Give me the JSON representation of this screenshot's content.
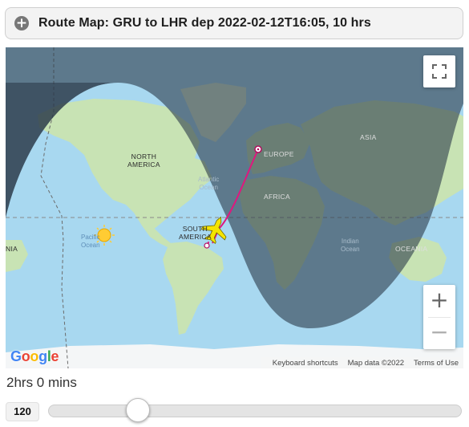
{
  "header": {
    "title": "Route Map: GRU to LHR dep 2022-02-12T16:05, 10 hrs",
    "expand_icon": "plus-circle-icon"
  },
  "map": {
    "labels": {
      "north_america": "NORTH\nAMERICA",
      "south_america": "SOUTH\nAMERICA",
      "europe": "EUROPE",
      "africa": "AFRICA",
      "asia": "ASIA",
      "oceania": "OCEANIA",
      "oceania_left": "NIA",
      "atlantic": "Atlantic\nOcean",
      "pacific": "Pacific\nOcean",
      "indian": "Indian\nOcean"
    },
    "route": {
      "origin": "GRU",
      "destination": "LHR"
    },
    "icons": {
      "plane": "airplane-icon",
      "sun": "sun-icon",
      "fullscreen": "fullscreen-icon"
    },
    "zoom_in_label": "+",
    "zoom_out_label": "−",
    "google_logo": [
      "G",
      "o",
      "o",
      "g",
      "l",
      "e"
    ],
    "attribution": {
      "shortcuts": "Keyboard shortcuts",
      "map_data": "Map data ©2022",
      "terms": "Terms of Use"
    },
    "colors": {
      "ocean": "#a8d8f0",
      "land": "#c8e3b4",
      "night": "#2b3a4a",
      "route": "#e0177e",
      "plane": "#f5e400"
    }
  },
  "slider": {
    "duration_text": "2hrs 0 mins",
    "value": "120",
    "fraction": 0.2
  }
}
